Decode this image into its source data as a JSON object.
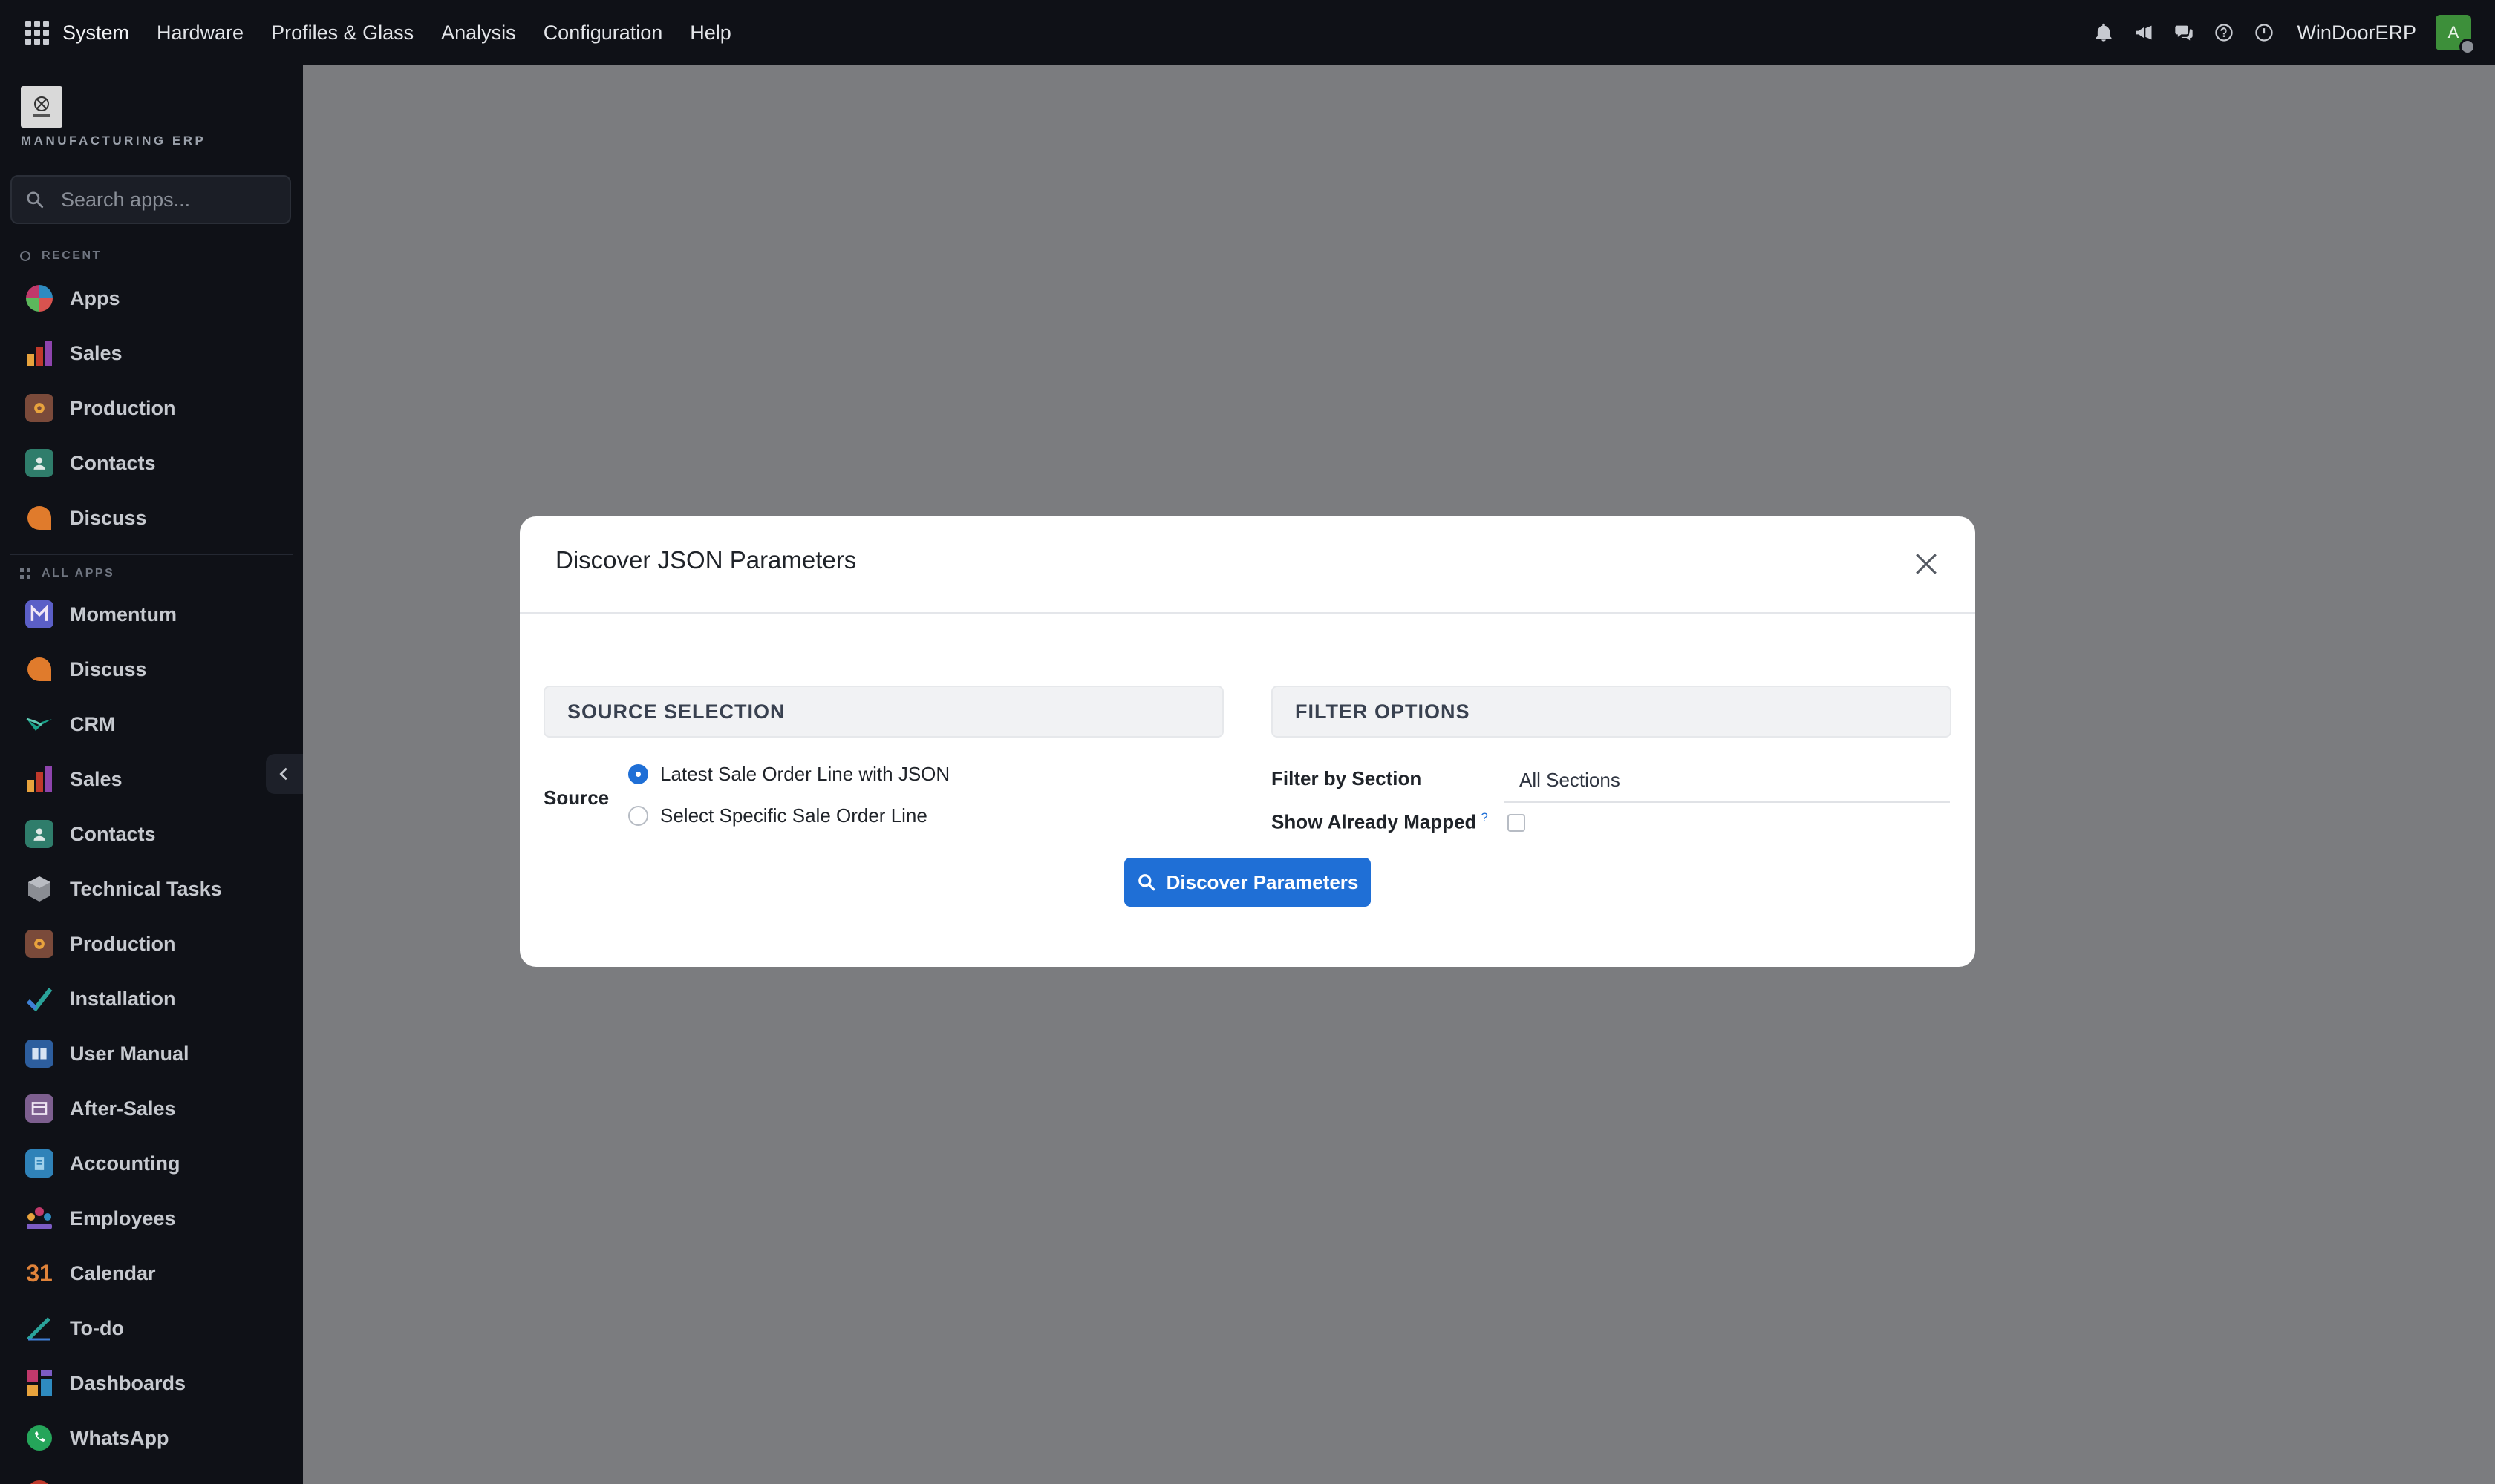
{
  "topbar": {
    "menu": [
      "System",
      "Hardware",
      "Profiles & Glass",
      "Analysis",
      "Configuration",
      "Help"
    ],
    "company": "WinDoorERP",
    "avatar_letter": "A"
  },
  "sidebar": {
    "logo_text": "MANUFACTURING ERP",
    "search_placeholder": "Search apps...",
    "recent_label": "RECENT",
    "all_apps_label": "ALL APPS",
    "recent": [
      "Apps",
      "Sales",
      "Production",
      "Contacts",
      "Discuss"
    ],
    "all_apps": [
      "Momentum",
      "Discuss",
      "CRM",
      "Sales",
      "Contacts",
      "Technical Tasks",
      "Production",
      "Installation",
      "User Manual",
      "After-Sales",
      "Accounting",
      "Employees",
      "Calendar",
      "To-do",
      "Dashboards",
      "WhatsApp"
    ],
    "calendar_icon_text": "31"
  },
  "modal": {
    "title": "Discover JSON Parameters",
    "source_section": "SOURCE SELECTION",
    "filter_section": "FILTER OPTIONS",
    "source_label": "Source",
    "source_options": [
      "Latest Sale Order Line with JSON",
      "Select Specific Sale Order Line"
    ],
    "source_selected": "Latest Sale Order Line with JSON",
    "filter_by_section_label": "Filter by Section",
    "filter_by_section_value": "All Sections",
    "show_already_mapped_label": "Show Already Mapped",
    "show_already_mapped_help": "?",
    "show_already_mapped_checked": false,
    "discover_button": "Discover Parameters"
  },
  "colors": {
    "primary": "#1f6fd6",
    "topbar_bg": "#0f1117",
    "backdrop": "#7b7c7f"
  }
}
